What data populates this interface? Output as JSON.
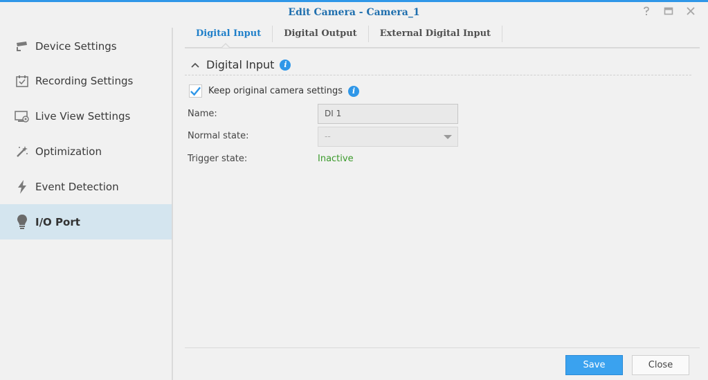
{
  "window": {
    "title": "Edit Camera - Camera_1",
    "controls": [
      "help-icon",
      "maximize-icon",
      "close-icon"
    ]
  },
  "sidebar": {
    "items": [
      {
        "label": "Device Settings",
        "icon": "camera-icon",
        "active": false
      },
      {
        "label": "Recording Settings",
        "icon": "calendar-check-icon",
        "active": false
      },
      {
        "label": "Live View Settings",
        "icon": "monitor-icon",
        "active": false
      },
      {
        "label": "Optimization",
        "icon": "magic-wand-icon",
        "active": false
      },
      {
        "label": "Event Detection",
        "icon": "lightning-icon",
        "active": false
      },
      {
        "label": "I/O Port",
        "icon": "lightbulb-icon",
        "active": true
      }
    ]
  },
  "tabs": [
    {
      "label": "Digital Input",
      "active": true
    },
    {
      "label": "Digital Output",
      "active": false
    },
    {
      "label": "External Digital Input",
      "active": false
    }
  ],
  "section": {
    "title": "Digital Input",
    "keep_settings": {
      "label": "Keep original camera settings",
      "checked": true
    },
    "name_label": "Name:",
    "name_value": "DI 1",
    "normal_state_label": "Normal state:",
    "normal_state_value": "--",
    "trigger_state_label": "Trigger state:",
    "trigger_state_value": "Inactive"
  },
  "footer": {
    "save_label": "Save",
    "close_label": "Close"
  },
  "colors": {
    "accent": "#2f97e8",
    "active_tab": "#1f7fc9",
    "sidebar_active_bg": "#d4e5ef",
    "status_inactive": "#3a9a2a"
  }
}
